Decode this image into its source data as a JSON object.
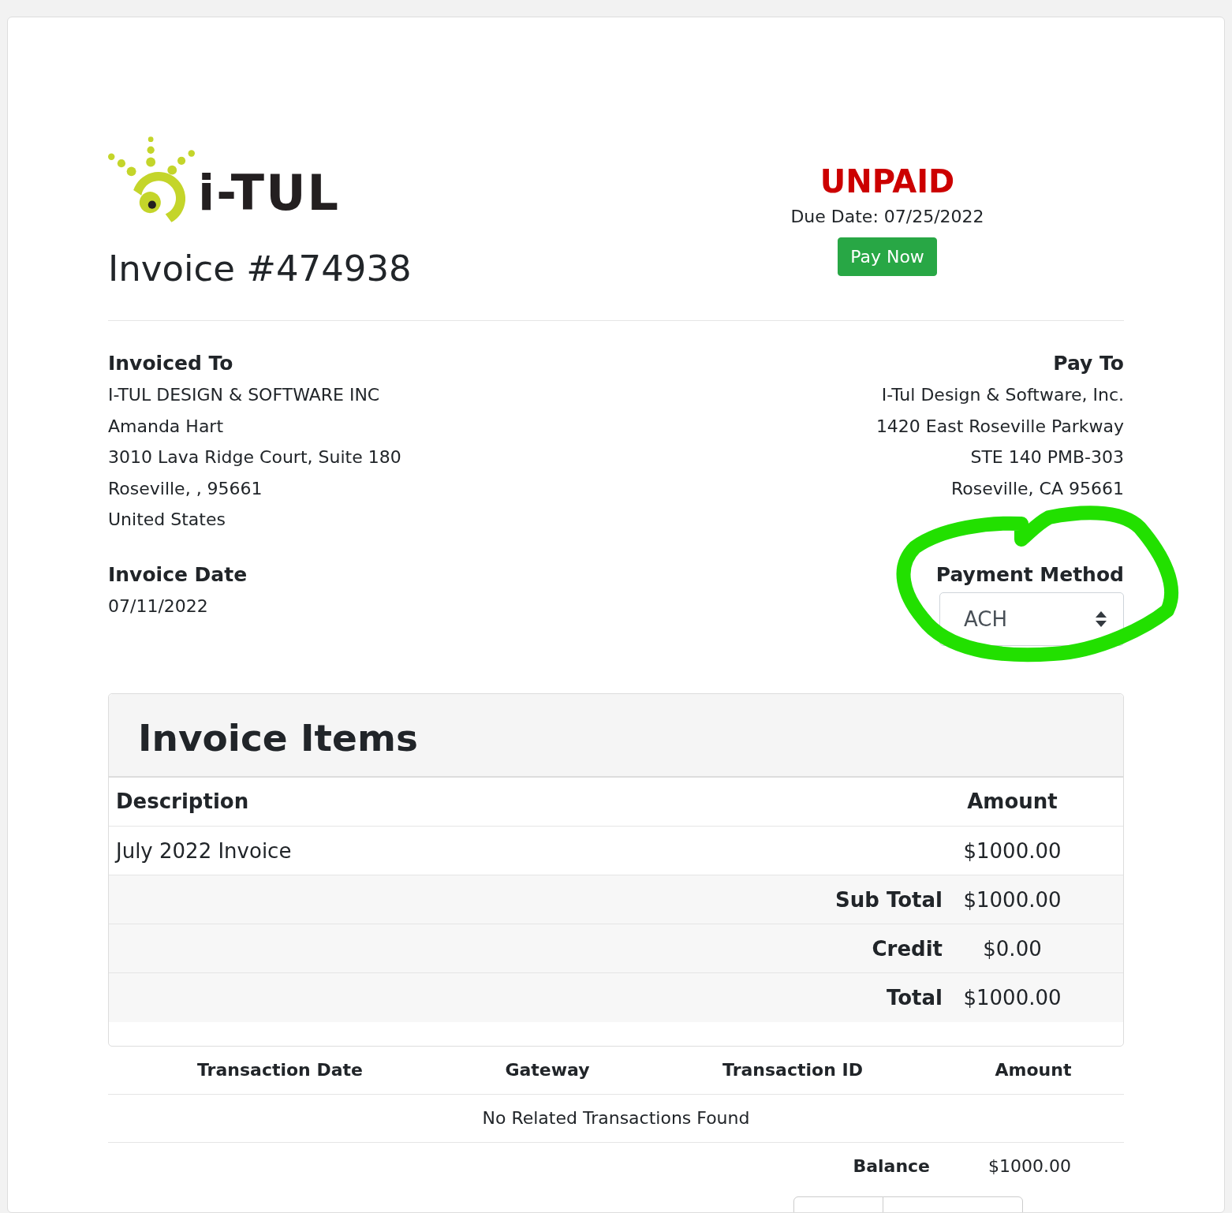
{
  "logo": {
    "text": "i-TUL"
  },
  "invoice": {
    "title": "Invoice #474938",
    "status": "UNPAID",
    "due_date": "Due Date: 07/25/2022",
    "pay_button": "Pay Now"
  },
  "invoiced_to": {
    "heading": "Invoiced To",
    "lines": [
      "I-TUL DESIGN & SOFTWARE INC",
      "Amanda Hart",
      "3010 Lava Ridge Court, Suite 180",
      "Roseville, , 95661",
      "United States"
    ]
  },
  "pay_to": {
    "heading": "Pay To",
    "lines": [
      "I-Tul Design & Software, Inc.",
      "1420 East Roseville Parkway",
      "STE 140 PMB-303",
      "Roseville, CA 95661"
    ]
  },
  "invoice_date": {
    "heading": "Invoice Date",
    "value": "07/11/2022"
  },
  "payment_method": {
    "heading": "Payment Method",
    "value": "ACH"
  },
  "items": {
    "title": "Invoice Items",
    "columns": [
      "Description",
      "Amount"
    ],
    "rows": [
      {
        "description": "July 2022 Invoice",
        "amount": "$1000.00"
      }
    ],
    "totals": [
      {
        "label": "Sub Total",
        "amount": "$1000.00"
      },
      {
        "label": "Credit",
        "amount": "$0.00"
      },
      {
        "label": "Total",
        "amount": "$1000.00"
      }
    ]
  },
  "transactions": {
    "columns": [
      "Transaction Date",
      "Gateway",
      "Transaction ID",
      "Amount"
    ],
    "empty_message": "No Related Transactions Found",
    "balance_label": "Balance",
    "balance": "$1000.00"
  }
}
